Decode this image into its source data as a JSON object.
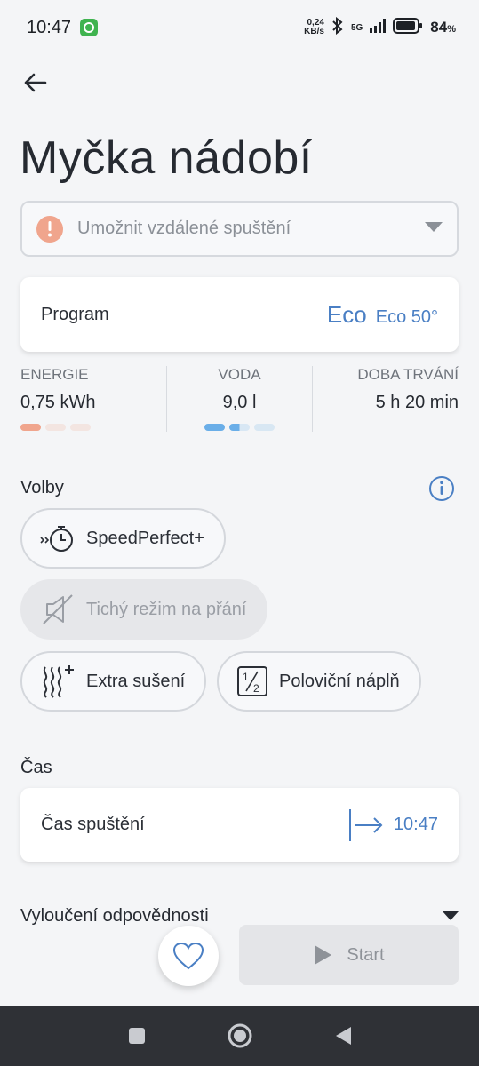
{
  "status_bar": {
    "time": "10:47",
    "net_speed_value": "0,24",
    "net_speed_unit": "KB/s",
    "network": "5G",
    "battery_percent": "84",
    "battery_sign": "%"
  },
  "header": {
    "title": "Myčka nádobí"
  },
  "remote_start": {
    "label": "Umožnit vzdálené spuštění"
  },
  "program": {
    "label": "Program",
    "logo": "Eco",
    "value": "Eco 50°"
  },
  "stats": [
    {
      "label": "ENERGIE",
      "value": "0,75 kWh",
      "level": 1,
      "max": 3,
      "color": "#f0a58d"
    },
    {
      "label": "VODA",
      "value": "9,0 l",
      "level": 1.5,
      "max": 3,
      "color": "#6aaee8"
    },
    {
      "label": "DOBA TRVÁNÍ",
      "value": "5 h 20 min"
    }
  ],
  "options": {
    "title": "Volby",
    "chips": [
      {
        "label": "SpeedPerfect+",
        "enabled": true
      },
      {
        "label": "Tichý režim na přání",
        "enabled": false
      },
      {
        "label": "Extra sušení",
        "enabled": true
      },
      {
        "label": "Poloviční náplň",
        "enabled": true
      }
    ]
  },
  "time": {
    "title": "Čas",
    "label": "Čas spuštění",
    "value": "10:47"
  },
  "disclaimer": {
    "label": "Vyloučení odpovědnosti"
  },
  "actions": {
    "start_label": "Start"
  },
  "colors": {
    "accent": "#4a7fc4",
    "warning": "#f0a58d",
    "water": "#6aaee8"
  }
}
